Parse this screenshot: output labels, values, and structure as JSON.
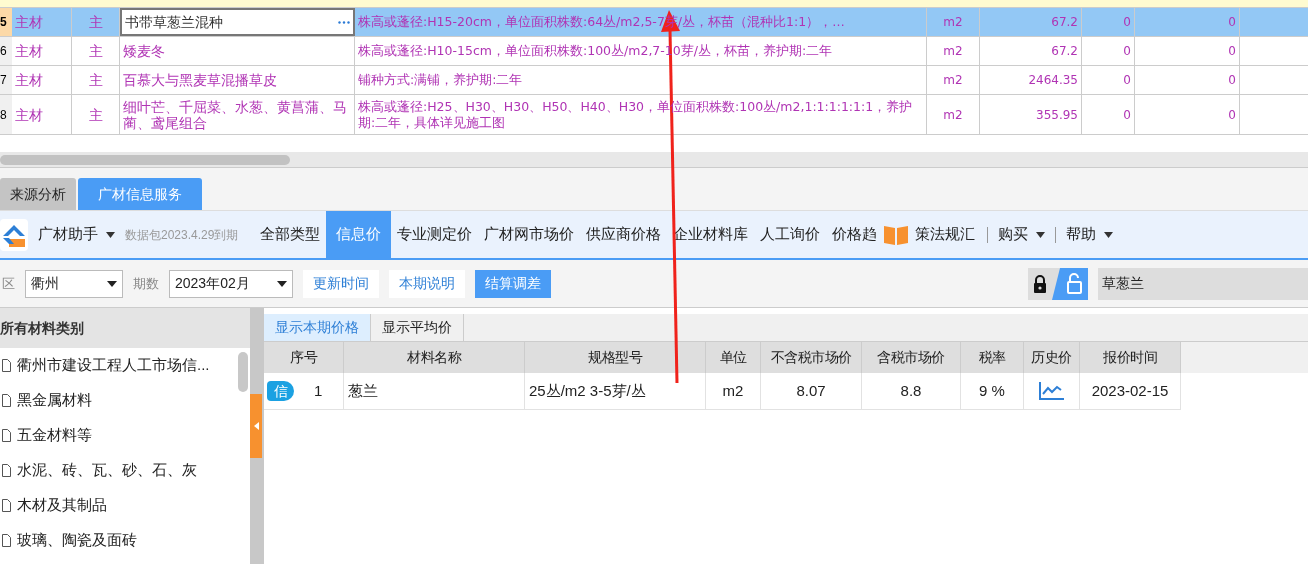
{
  "grid": {
    "rows": [
      {
        "number": "5",
        "type": "主材",
        "main": "主",
        "name": "书带草葱兰混种",
        "spec": "株高或蓬径:H15-20cm，单位面积株数:64丛/m2,5-7芽/丛，杯苗（混种比1:1），…",
        "unit": "m2",
        "quantity": "67.2",
        "column_8": "0",
        "column_9": "0",
        "selected": true
      },
      {
        "number": "6",
        "type": "主材",
        "main": "主",
        "name": "矮麦冬",
        "spec": "株高或蓬径:H10-15cm，单位面积株数:100丛/m2,7-10芽/丛，杯苗，养护期:二年",
        "unit": "m2",
        "quantity": "67.2",
        "column_8": "0",
        "column_9": "0",
        "selected": false
      },
      {
        "number": "7",
        "type": "主材",
        "main": "主",
        "name": "百慕大与黑麦草混播草皮",
        "spec": "铺种方式:满铺，养护期:二年",
        "unit": "m2",
        "quantity": "2464.35",
        "column_8": "0",
        "column_9": "0",
        "selected": false
      },
      {
        "number": "8",
        "type": "主材",
        "main": "主",
        "name": "细叶芒、千屈菜、水葱、黄菖蒲、马蔺、鸢尾组合",
        "spec": "株高或蓬径:H25、H30、H30、H50、H40、H30，单位面积株数:100丛/m2,1:1:1:1:1:1，养护期:二年，具体详见施工图",
        "unit": "m2",
        "quantity": "355.95",
        "column_8": "0",
        "column_9": "0",
        "selected": false
      }
    ]
  },
  "bottom_tabs": [
    {
      "label": "来源分析",
      "selected": false
    },
    {
      "label": "广材信息服务",
      "selected": true
    }
  ],
  "toolbar": {
    "app_name": "广材助手",
    "package_note": "数据包2023.4.29到期",
    "nav": [
      {
        "label": "全部类型",
        "selected": false
      },
      {
        "label": "信息价",
        "selected": true
      },
      {
        "label": "专业测定价",
        "selected": false
      },
      {
        "label": "广材网市场价",
        "selected": false
      },
      {
        "label": "供应商价格",
        "selected": false
      },
      {
        "label": "企业材料库",
        "selected": false
      },
      {
        "label": "人工询价",
        "selected": false
      },
      {
        "label": "价格趋",
        "selected": false
      },
      {
        "label": "策法规汇",
        "selected": false
      }
    ],
    "menus": [
      "购买",
      "帮助"
    ]
  },
  "filters": {
    "region_label": "区",
    "region": "衢州",
    "period_label": "期数",
    "period": "2023年02月",
    "buttons": [
      {
        "label": "更新时间",
        "selected": false
      },
      {
        "label": "本期说明",
        "selected": false
      },
      {
        "label": "结算调差",
        "selected": true
      }
    ],
    "search": {
      "value": "草葱兰"
    }
  },
  "sidebar": {
    "title": "所有材料类别",
    "items": [
      "衢州市建设工程人工市场信...",
      "黑金属材料",
      "五金材料等",
      "水泥、砖、瓦、砂、石、灰",
      "木材及其制品",
      "玻璃、陶瓷及面砖"
    ]
  },
  "price_tabs": [
    {
      "label": "显示本期价格",
      "selected": true
    },
    {
      "label": "显示平均价",
      "selected": false
    }
  ],
  "price_table": {
    "columns": [
      "序号",
      "材料名称",
      "规格型号",
      "单位",
      "不含税市场价",
      "含税市场价",
      "税率",
      "历史价",
      "报价时间"
    ],
    "rows": [
      {
        "badge": "信",
        "number": "1",
        "name": "葱兰",
        "spec": "25丛/m2 3-5芽/丛",
        "unit": "m2",
        "price_ex_tax": "8.07",
        "price_inc_tax": "8.8",
        "tax_rate": "9 %",
        "quote_date": "2023-02-15"
      }
    ]
  }
}
